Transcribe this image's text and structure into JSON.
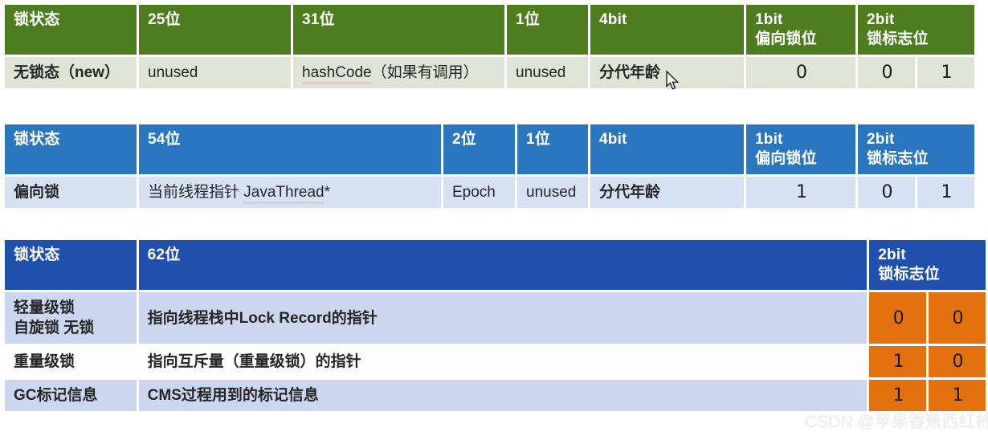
{
  "meta": {
    "watermark": "CSDN @苹果香蕉西红柿",
    "cursor_icon": "mouse-pointer-icon"
  },
  "colors": {
    "green_header": "#4d7d1f",
    "green_row": "#dfe4d7",
    "blue_header": "#2a77bf",
    "blue_row": "#d7e1f4",
    "deep_blue_header": "#1f50ad",
    "deep_blue_row": "#ccd6ef",
    "white_row": "#fdfdfe",
    "orange_bit": "#e2710e",
    "watermark": "#efefef"
  },
  "tables": [
    {
      "id": "unlocked",
      "accent": "#4d7d1f",
      "headers": [
        {
          "line1": "锁状态",
          "line2": ""
        },
        {
          "line1": "25位",
          "line2": ""
        },
        {
          "line1": "31位",
          "line2": ""
        },
        {
          "line1": "1位",
          "line2": ""
        },
        {
          "line1": "4bit",
          "line2": ""
        },
        {
          "line1": "1bit",
          "line2": "偏向锁位"
        },
        {
          "line1": "2bit",
          "line2": "锁标志位"
        }
      ],
      "rows": [
        {
          "state": "无锁态（new）",
          "cells": [
            "unused",
            "hashCode（如果有调用）",
            "unused",
            "分代年龄"
          ],
          "hashcode_word": "hashCode",
          "hashcode_rest": "（如果有调用）",
          "biased_bit": "0",
          "lock_bits": [
            "0",
            "1"
          ]
        }
      ]
    },
    {
      "id": "biased",
      "accent": "#2a77bf",
      "headers": [
        {
          "line1": "锁状态",
          "line2": ""
        },
        {
          "line1": "54位",
          "line2": ""
        },
        {
          "line1": "2位",
          "line2": ""
        },
        {
          "line1": "1位",
          "line2": ""
        },
        {
          "line1": "4bit",
          "line2": ""
        },
        {
          "line1": "1bit",
          "line2": "偏向锁位"
        },
        {
          "line1": "2bit",
          "line2": "锁标志位"
        }
      ],
      "rows": [
        {
          "state": "偏向锁",
          "cells": [
            "当前线程指针 JavaThread*",
            "Epoch",
            "unused",
            "分代年龄"
          ],
          "thread_prefix": "当前线程指针 ",
          "thread_word": "JavaThread",
          "thread_suffix": "*",
          "biased_bit": "1",
          "lock_bits": [
            "0",
            "1"
          ]
        }
      ]
    },
    {
      "id": "lightweight",
      "accent": "#1f50ad",
      "headers": [
        {
          "line1": "锁状态",
          "line2": ""
        },
        {
          "line1": "62位",
          "line2": ""
        },
        {
          "line1": "2bit",
          "line2": "锁标志位"
        }
      ],
      "rows": [
        {
          "state_line1": "轻量级锁",
          "state_line2": "自旋锁 无锁",
          "desc": "指向线程栈中Lock Record的指针",
          "lock_bits": [
            "0",
            "0"
          ]
        },
        {
          "state_line1": "重量级锁",
          "state_line2": "",
          "desc": "指向互斥量（重量级锁）的指针",
          "lock_bits": [
            "1",
            "0"
          ]
        },
        {
          "state_line1": "GC标记信息",
          "state_line2": "",
          "desc": "CMS过程用到的标记信息",
          "lock_bits": [
            "1",
            "1"
          ]
        }
      ]
    }
  ]
}
